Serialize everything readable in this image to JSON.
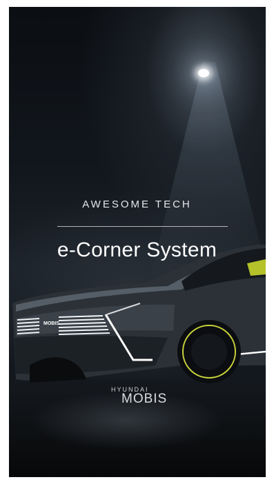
{
  "video": {
    "eyebrow": "AWESOME TECH",
    "title": "e-Corner System"
  },
  "brand": {
    "top": "HYUNDAI",
    "main": "MOBIS"
  },
  "grille_badge": "MOBIS",
  "colors": {
    "background": "#10151b",
    "text": "#ffffff",
    "accent_wheel": "#c8d23a",
    "spotlight": "#ffffff"
  }
}
